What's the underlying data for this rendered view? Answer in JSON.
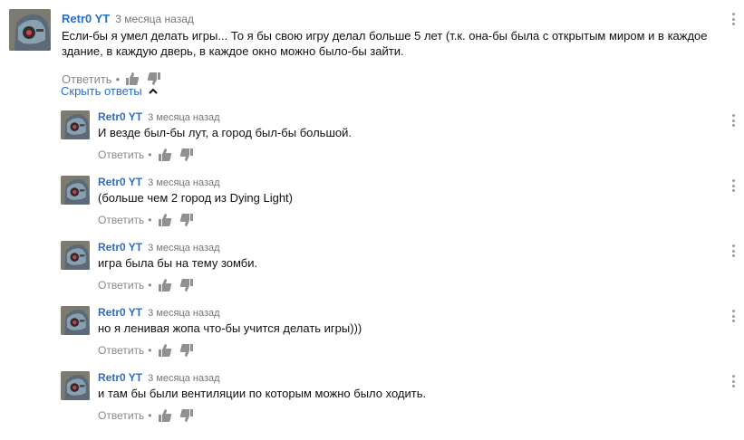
{
  "main_comment": {
    "author": "Retr0 YT",
    "time": "3 месяца назад",
    "text": "Если-бы я умел делать игры... То я бы свою игру делал больше 5 лет (т.к. она-бы была с открытым миром и в каждое здание, в каждую дверь, в каждое окно можно было-бы зайти.",
    "reply_label": "Ответить",
    "dot": "•",
    "avatar_icon": "robot-avatar-icon"
  },
  "hide_replies_label": "Скрыть ответы",
  "replies": [
    {
      "author": "Retr0 YT",
      "time": "3 месяца назад",
      "text": "И везде был-бы лут, а город был-бы большой.",
      "reply_label": "Ответить",
      "dot": "•"
    },
    {
      "author": "Retr0 YT",
      "time": "3 месяца назад",
      "text": "(больше чем 2 город из Dying Light)",
      "reply_label": "Ответить",
      "dot": "•"
    },
    {
      "author": "Retr0 YT",
      "time": "3 месяца назад",
      "text": "игра была бы на тему зомби.",
      "reply_label": "Ответить",
      "dot": "•"
    },
    {
      "author": "Retr0 YT",
      "time": "3 месяца назад",
      "text": "но я ленивая жопа что-бы учится делать игры)))",
      "reply_label": "Ответить",
      "dot": "•"
    },
    {
      "author": "Retr0 YT",
      "time": "3 месяца назад",
      "text": "и там бы были вентиляции по которым можно было ходить.",
      "reply_label": "Ответить",
      "dot": "•"
    }
  ],
  "colors": {
    "author": "#2a6ccc",
    "link": "#2a6ccc",
    "meta": "#767676",
    "icon": "#909090"
  }
}
